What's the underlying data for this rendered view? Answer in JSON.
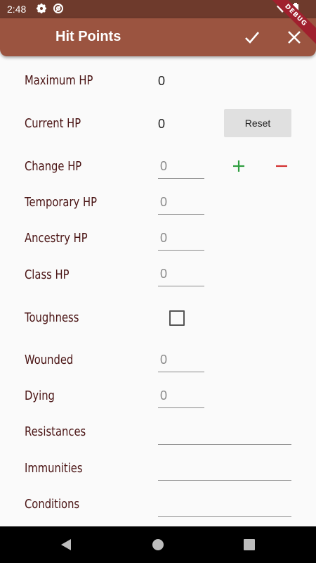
{
  "status_bar": {
    "time": "2:48",
    "icons": [
      "gear-icon",
      "at-sign-icon",
      "wifi-icon",
      "battery-icon"
    ]
  },
  "debug_banner": "DEBUG",
  "app_bar": {
    "title": "Hit Points",
    "actions": [
      "check-icon",
      "close-icon"
    ]
  },
  "colors": {
    "app_bar": "#9b5440",
    "status_bar": "#6e3a2c",
    "label": "#4a1414",
    "plus": "#2e9e3f",
    "minus": "#d32f2f"
  },
  "form": {
    "maximum_hp": {
      "label": "Maximum HP",
      "value": "0"
    },
    "current_hp": {
      "label": "Current HP",
      "value": "0",
      "reset_label": "Reset"
    },
    "change_hp": {
      "label": "Change HP",
      "placeholder": "0"
    },
    "temporary_hp": {
      "label": "Temporary HP",
      "placeholder": "0"
    },
    "ancestry_hp": {
      "label": "Ancestry HP",
      "placeholder": "0"
    },
    "class_hp": {
      "label": "Class HP",
      "placeholder": "0"
    },
    "toughness": {
      "label": "Toughness",
      "checked": false
    },
    "wounded": {
      "label": "Wounded",
      "placeholder": "0"
    },
    "dying": {
      "label": "Dying",
      "placeholder": "0"
    },
    "resistances": {
      "label": "Resistances",
      "value": ""
    },
    "immunities": {
      "label": "Immunities",
      "value": ""
    },
    "conditions": {
      "label": "Conditions",
      "value": ""
    }
  },
  "nav_bar": [
    "back-icon",
    "home-icon",
    "recents-icon"
  ]
}
